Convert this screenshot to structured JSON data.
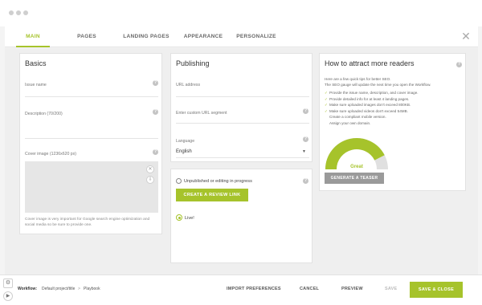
{
  "tabs": [
    {
      "label": "MAIN"
    },
    {
      "label": "PAGES"
    },
    {
      "label": "LANDING PAGES"
    },
    {
      "label": "APPEARANCE"
    },
    {
      "label": "PERSONALIZE"
    }
  ],
  "basics": {
    "title": "Basics",
    "issue_name_label": "Issue name",
    "description_label": "Description (70/200)",
    "cover_label": "Cover image (1236x620 px)",
    "cover_note": "Cover image is very important for Google search engine optimization and social media so be sure to provide one."
  },
  "publishing": {
    "title": "Publishing",
    "url_label": "URL address",
    "custom_url_label": "Enter custom URL segment",
    "language_label": "Language",
    "language_value": "English",
    "status_text": "Unpublished or editing in progress",
    "review_button": "CREATE A REVIEW LINK",
    "live_label": "Live!"
  },
  "seo": {
    "title": "How to attract more readers",
    "intro_1": "Here are a few quick tips for better SEO.",
    "intro_2": "The SEO gauge will update the next time you open the Workflow.",
    "tips": [
      {
        "mark": "✓",
        "text": "Provide the issue name, description, and cover image."
      },
      {
        "mark": "✓",
        "text": "Provide detailed info for at least 4 landing pages."
      },
      {
        "mark": "✓",
        "text": "Make sure uploaded images don't exceed 800KB."
      },
      {
        "mark": "✓",
        "text": "Make sure uploaded videos don't exceed 54MB."
      },
      {
        "mark": "",
        "text": "Create a compliant mobile version."
      },
      {
        "mark": "",
        "text": "Assign your own domain."
      }
    ],
    "gauge_label": "Great",
    "gauge_value": 0.85,
    "teaser_button": "GENERATE A TEASER"
  },
  "footer": {
    "workflow_label": "Workflow:",
    "breadcrumb_1": "Default project/title",
    "breadcrumb_sep": ">",
    "breadcrumb_2": "Playbook",
    "import_label": "IMPORT PREFERENCES",
    "cancel_label": "CANCEL",
    "preview_label": "PREVIEW",
    "save_label": "SAVE",
    "save_close_label": "SAVE & CLOSE"
  },
  "colors": {
    "accent": "#a6c32b",
    "gauge_track": "#e0e0e0"
  }
}
